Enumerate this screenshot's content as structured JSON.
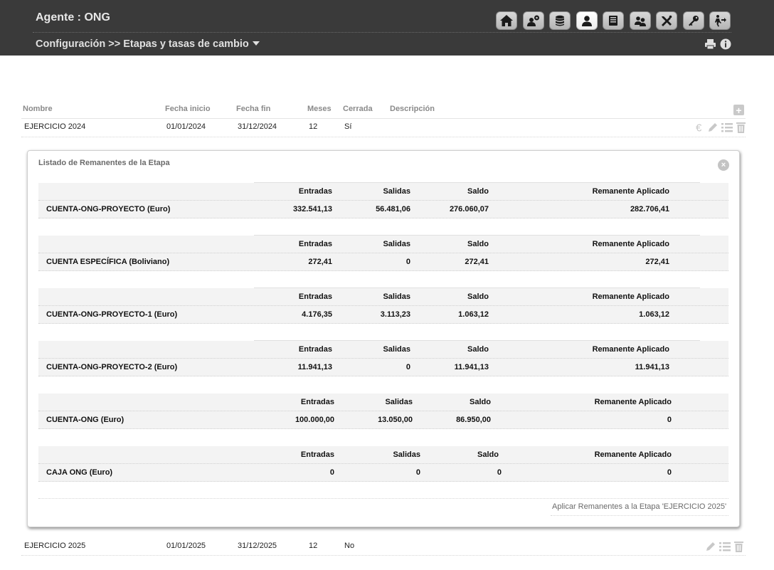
{
  "header": {
    "agent": "Agente : ONG",
    "breadcrumb": "Configuración >> Etapas y tasas de cambio",
    "toolbar": [
      {
        "icon": "home-icon"
      },
      {
        "icon": "users-settings-icon"
      },
      {
        "icon": "database-icon"
      },
      {
        "icon": "user-icon",
        "active": true
      },
      {
        "icon": "ledger-icon"
      },
      {
        "icon": "group-icon"
      },
      {
        "icon": "tools-icon"
      },
      {
        "icon": "key-icon"
      },
      {
        "icon": "logout-icon"
      }
    ]
  },
  "table": {
    "columns": [
      "Nombre",
      "Fecha inicio",
      "Fecha fin",
      "Meses",
      "Cerrada",
      "Descripción"
    ],
    "rows": [
      {
        "nombre": "EJERCICIO 2024",
        "inicio": "01/01/2024",
        "fin": "31/12/2024",
        "meses": "12",
        "cerrada": "Sí",
        "descripcion": ""
      },
      {
        "nombre": "EJERCICIO 2025",
        "inicio": "01/01/2025",
        "fin": "31/12/2025",
        "meses": "12",
        "cerrada": "No",
        "descripcion": ""
      }
    ]
  },
  "panel": {
    "title": "Listado de Remanentes de la Etapa",
    "headers": [
      "Entradas",
      "Salidas",
      "Saldo",
      "Remanente Aplicado"
    ],
    "accounts": [
      {
        "name": "CUENTA-ONG-PROYECTO (Euro)",
        "entradas": "332.541,13",
        "salidas": "56.481,06",
        "saldo": "276.060,07",
        "remanente": "282.706,41"
      },
      {
        "name": "CUENTA ESPECÍFICA (Boliviano)",
        "entradas": "272,41",
        "salidas": "0",
        "saldo": "272,41",
        "remanente": "272,41"
      },
      {
        "name": "CUENTA-ONG-PROYECTO-1 (Euro)",
        "entradas": "4.176,35",
        "salidas": "3.113,23",
        "saldo": "1.063,12",
        "remanente": "1.063,12"
      },
      {
        "name": "CUENTA-ONG-PROYECTO-2 (Euro)",
        "entradas": "11.941,13",
        "salidas": "0",
        "saldo": "11.941,13",
        "remanente": "11.941,13"
      },
      {
        "name": "CUENTA-ONG (Euro)",
        "entradas": "100.000,00",
        "salidas": "13.050,00",
        "saldo": "86.950,00",
        "remanente": "0"
      },
      {
        "name": "CAJA ONG (Euro)",
        "entradas": "0",
        "salidas": "0",
        "saldo": "0",
        "remanente": "0"
      }
    ],
    "apply_link": "Aplicar Remanentes a la Etapa 'EJERCICIO 2025'"
  }
}
